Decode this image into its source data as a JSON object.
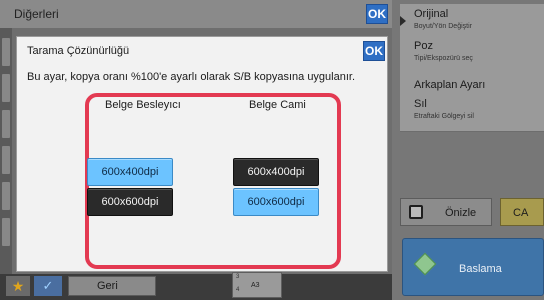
{
  "top_bar": {
    "title": "Diğerleri",
    "ok_label": "OK"
  },
  "right_panel": {
    "items": [
      {
        "label": "Orijinal",
        "sub": "Boyut/Yön Değiştir"
      },
      {
        "label": "Poz",
        "sub": "Tipi/Ekspozürü seç"
      },
      {
        "label": "Arkaplan Ayarı",
        "sub": ""
      },
      {
        "label": "Sıl",
        "sub": "Etraftaki Gölgeyi sil"
      }
    ],
    "preview_label": "Önizle",
    "ca_label": "CA",
    "start_label": "Baslama"
  },
  "bottom_bar": {
    "back_label": "Geri",
    "paper_label": "A3",
    "tray_numbers": [
      "3",
      "4"
    ]
  },
  "dialog": {
    "title": "Tarama Çözünürlüğü",
    "ok_label": "OK",
    "description": "Bu ayar, kopya oranı %100'e ayarlı olarak S/B kopyasına uygulanır.",
    "columns": [
      {
        "heading": "Belge Besleyıcı",
        "options": [
          {
            "label": "600x400dpi",
            "selected": true
          },
          {
            "label": "600x600dpi",
            "selected": false
          }
        ]
      },
      {
        "heading": "Belge Cami",
        "options": [
          {
            "label": "600x400dpi",
            "selected": false
          },
          {
            "label": "600x600dpi",
            "selected": true
          }
        ]
      }
    ]
  },
  "colors": {
    "highlight_frame": "#e33a52",
    "selected_button": "#6cc3ff",
    "unselected_button": "#2a2a2a",
    "ok_button": "#2f6fc4"
  }
}
